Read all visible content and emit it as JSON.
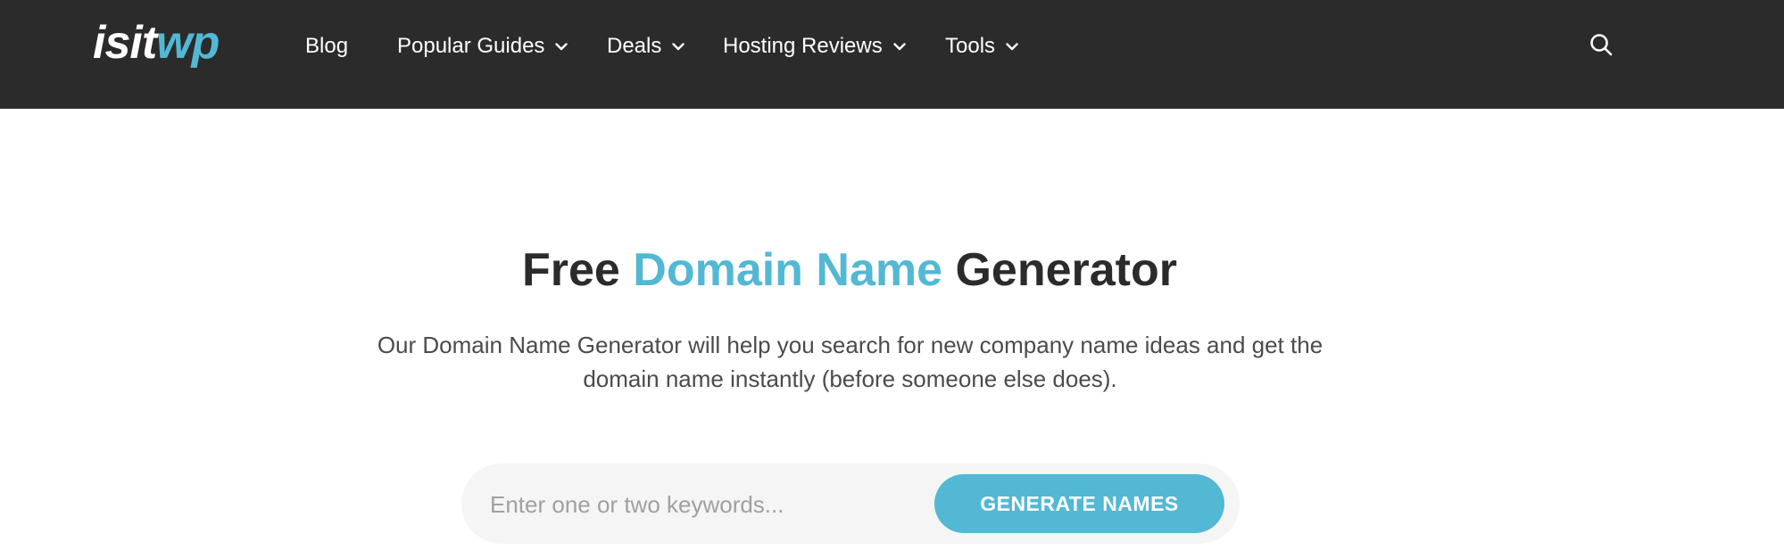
{
  "logo": {
    "part1": "isit",
    "part2": "wp"
  },
  "nav": {
    "blog": "Blog",
    "popular_guides": "Popular Guides",
    "deals": "Deals",
    "hosting_reviews": "Hosting Reviews",
    "tools": "Tools"
  },
  "hero": {
    "title_pre": "Free ",
    "title_highlight": "Domain Name",
    "title_post": " Generator",
    "description": "Our Domain Name Generator will help you search for new company name ideas and get the domain name instantly (before someone else does)."
  },
  "search": {
    "placeholder": "Enter one or two keywords...",
    "value": "",
    "button_label": "GENERATE NAMES"
  },
  "icons": {
    "search": "search-icon",
    "dropdown": "chevron-down-icon"
  },
  "colors": {
    "navbar_bg": "#2b2b2b",
    "accent": "#52b8d4",
    "form_bg": "#f5f5f5",
    "title_text": "#2b2b2b"
  }
}
